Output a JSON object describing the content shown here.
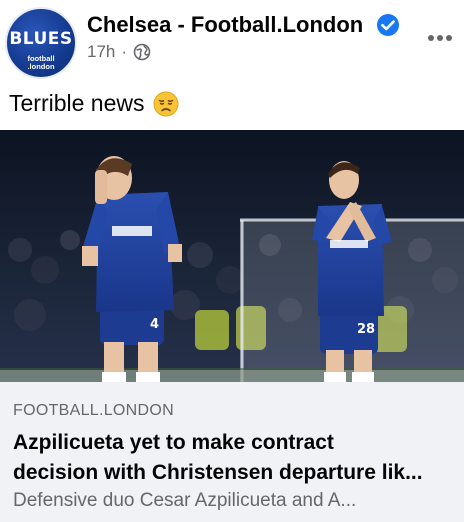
{
  "post": {
    "avatar": {
      "text": "BLUES",
      "sub_line1": "football",
      "sub_line2": ".london"
    },
    "page_name": "Chelsea - Football.London",
    "time": "17h",
    "separator": "·",
    "text": "Terrible news",
    "icons": {
      "verified": "verified-badge-icon",
      "audience": "globe-icon",
      "menu": "more-options-icon",
      "emoji": "disappointed-face-icon"
    },
    "colors": {
      "verified": "#1877f2",
      "preview_bg": "#f0f2f5",
      "secondary_text": "#65676b"
    }
  },
  "link": {
    "domain": "FOOTBALL.LONDON",
    "title_line1": "Azpilicueta yet to make contract",
    "title_line2": "decision with Christensen departure lik...",
    "description": "Defensive duo Cesar Azpilicueta and A...",
    "image": {
      "players": [
        {
          "shirt_number": "4"
        },
        {
          "shirt_number": "28"
        }
      ]
    }
  }
}
